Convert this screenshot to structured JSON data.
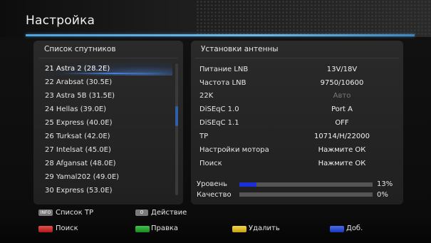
{
  "title": "Настройка",
  "satellites": {
    "header": "Список спутников",
    "items": [
      "21 Astra 2 (28.2E)",
      "22 Arabsat (30.5E)",
      "23 Astra 5B (31.5E)",
      "24 Hellas (39.0E)",
      "25 Express (40.0E)",
      "26 Turksat (42.0E)",
      "27 Intelsat (45.0E)",
      "28 Afgansat (48.0E)",
      "29 Yamal202 (49.0E)",
      "30 Express (53.0E)"
    ],
    "selected_index": 0,
    "scroll_fraction": 0.38
  },
  "antenna": {
    "header": "Установки антенны",
    "rows": [
      {
        "label": "Питание LNB",
        "value": "13V/18V"
      },
      {
        "label": "Частота LNB",
        "value": "9750/10600"
      },
      {
        "label": "22K",
        "value": "Авто"
      },
      {
        "label": "DiSEqC 1.0",
        "value": "Port A"
      },
      {
        "label": "DiSEqC 1.1",
        "value": "OFF"
      },
      {
        "label": "TP",
        "value": "10714/H/22000"
      },
      {
        "label": "Настройки мотора",
        "value": "Нажмите ОК"
      },
      {
        "label": "Поиск",
        "value": "Нажмите ОК"
      }
    ],
    "disabled_row_label": "22K"
  },
  "signal": {
    "level_label": "Уровень",
    "level_text": "13%",
    "level_value": 0.13,
    "quality_label": "Качество",
    "quality_text": "0%",
    "quality_value": 0.0
  },
  "legend": {
    "info_key": "INFO",
    "info_label": "Список TP",
    "zero_key": "0",
    "zero_label": "Действие",
    "red_label": "Поиск",
    "green_label": "Правка",
    "yellow_label": "Удалить",
    "blue_label": "Доб."
  },
  "colors": {
    "accent": "#4fa3dd",
    "signal_bar": "#1c2fd6",
    "red": "#d23030",
    "green": "#2aa834",
    "yellow": "#e8c12a",
    "blue": "#2f4fd0"
  }
}
